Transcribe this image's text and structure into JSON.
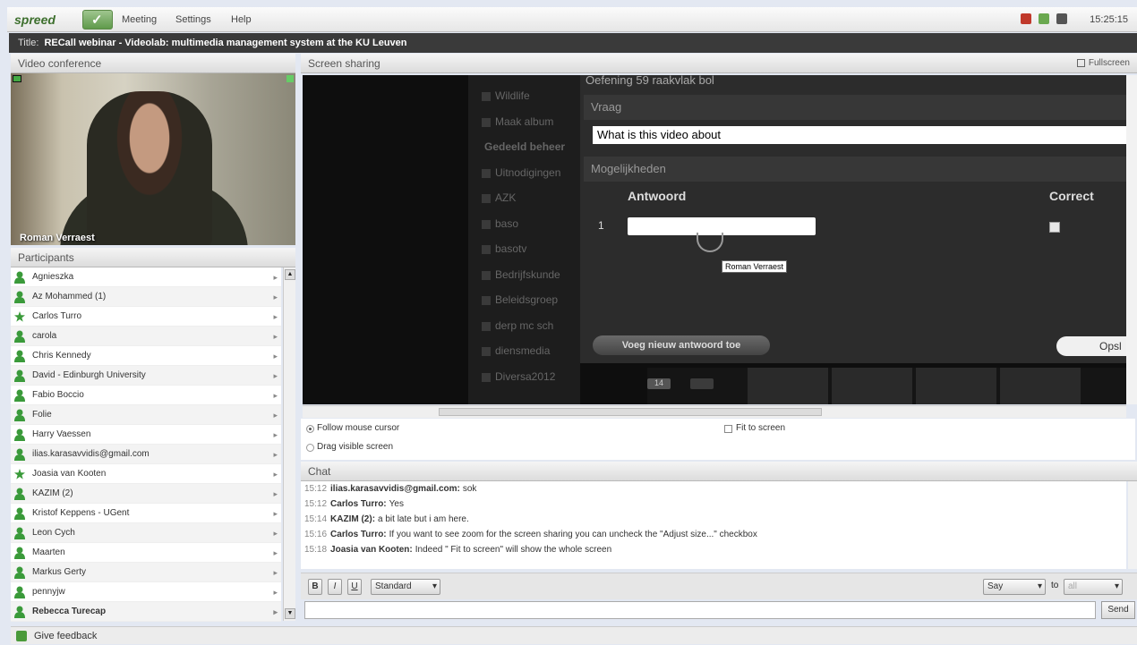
{
  "app": {
    "logo": "spreed",
    "time": "15:25:15"
  },
  "menu": {
    "meeting": "Meeting",
    "settings": "Settings",
    "help": "Help"
  },
  "title": {
    "label": "Title:",
    "text": "RECall webinar - Videolab: multimedia management system at the KU Leuven"
  },
  "video": {
    "header": "Video conference",
    "speaker": "Roman Verraest"
  },
  "participants": {
    "header": "Participants",
    "items": [
      "Agnieszka",
      "Az Mohammed (1)",
      "Carlos Turro",
      "carola",
      "Chris Kennedy",
      "David - Edinburgh University",
      "Fabio Boccio",
      "Folie",
      "Harry Vaessen",
      "ilias.karasavvidis@gmail.com",
      "Joasia van Kooten",
      "KAZIM (2)",
      "Kristof Keppens - UGent",
      "Leon Cych",
      "Maarten",
      "Markus Gerty",
      "pennyjw",
      "Rebecca Turecap"
    ]
  },
  "screen": {
    "header": "Screen sharing",
    "fullscreen": "Fullscreen",
    "left_menu": [
      "Wildlife",
      "Maak album",
      "Gedeeld beheer",
      "Uitnodigingen",
      "AZK",
      "baso",
      "basotv",
      "Bedrijfskunde",
      "Beleidsgroep",
      "derp mc sch",
      "diensmedia",
      "Diversa2012"
    ],
    "dialog": {
      "title": "Oefening 59 raakvlak bol",
      "vraag": "Vraag",
      "question": "What is this video about",
      "mogelijkheden": "Mogelijkheden",
      "antwoord": "Antwoord",
      "correct": "Correct",
      "row_num": "1",
      "tooltip": "Roman Verraest",
      "add_button": "Voeg nieuw antwoord toe",
      "save_button": "Opsl"
    },
    "thumb_badge": "14",
    "follow_cursor": "Follow mouse cursor",
    "drag_visible": "Drag visible screen",
    "fit_to_screen": "Fit to screen"
  },
  "chat": {
    "header": "Chat",
    "messages": [
      {
        "time": "15:12",
        "who": "ilias.karasavvidis@gmail.com:",
        "text": "sok"
      },
      {
        "time": "15:12",
        "who": "Carlos Turro:",
        "text": "Yes"
      },
      {
        "time": "15:14",
        "who": "KAZIM (2):",
        "text": "a bit late but i am here."
      },
      {
        "time": "15:16",
        "who": "Carlos Turro:",
        "text": "If you want to see zoom for the screen sharing you can uncheck the \"Adjust size...\" checkbox"
      },
      {
        "time": "15:18",
        "who": "Joasia van Kooten:",
        "text": "Indeed \" Fit to screen\" will show the whole screen"
      }
    ],
    "bold": "B",
    "italic": "I",
    "underline": "U",
    "style": "Standard",
    "say": "Say",
    "to": "to",
    "to_value": "all",
    "send": "Send"
  },
  "feedback": "Give feedback"
}
